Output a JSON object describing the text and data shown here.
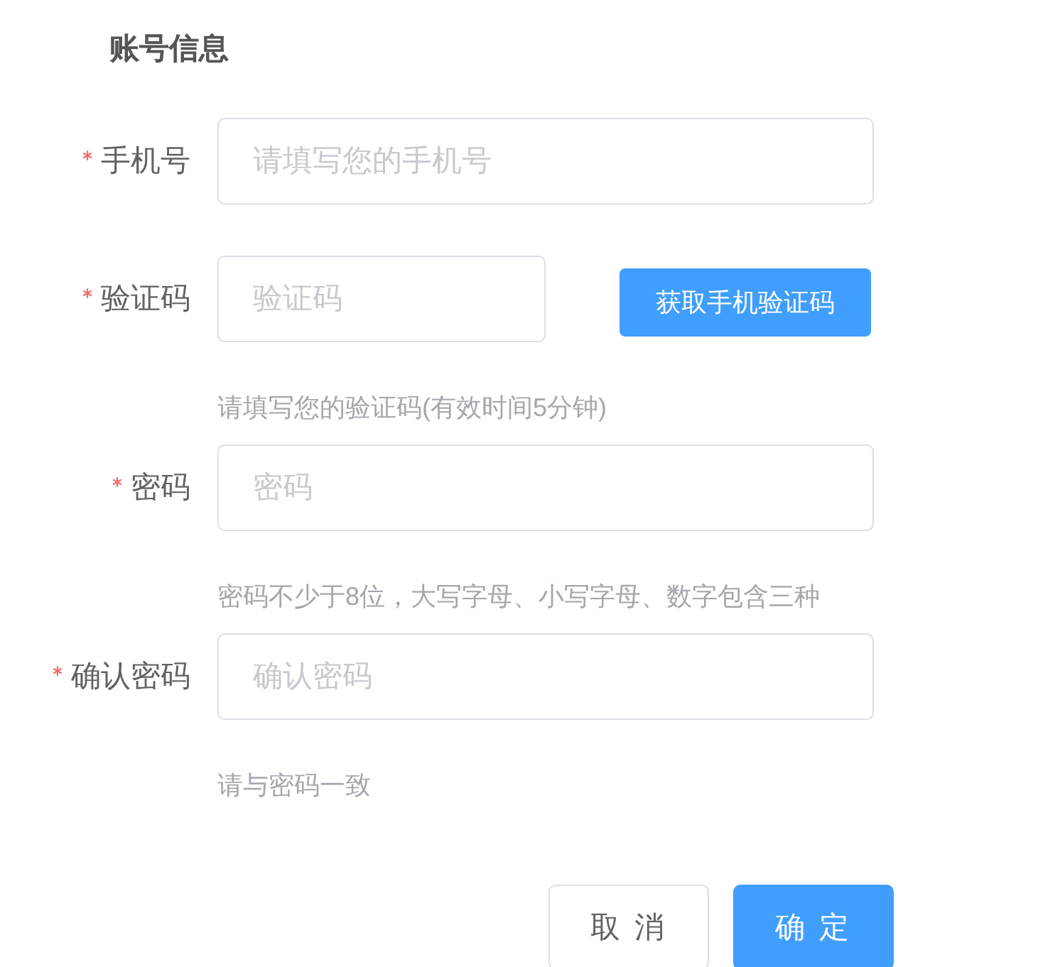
{
  "section_title": "账号信息",
  "fields": [
    {
      "kind": "input",
      "label": "手机号",
      "required": true,
      "placeholder": "请填写您的手机号"
    },
    {
      "kind": "input_with_button",
      "label": "验证码",
      "required": true,
      "placeholder": "验证码",
      "action": "获取手机验证码",
      "hint": "请填写您的验证码(有效时间5分钟)"
    },
    {
      "kind": "input",
      "label": "密码",
      "required": true,
      "placeholder": "密码",
      "hint": "密码不少于8位，大写字母、小写字母、数字包含三种"
    },
    {
      "kind": "input",
      "label": "确认密码",
      "required": true,
      "placeholder": "确认密码",
      "hint": "请与密码一致"
    }
  ],
  "buttons": [
    {
      "kind": "secondary",
      "label": "取 消"
    },
    {
      "kind": "primary",
      "label": "确 定"
    }
  ]
}
